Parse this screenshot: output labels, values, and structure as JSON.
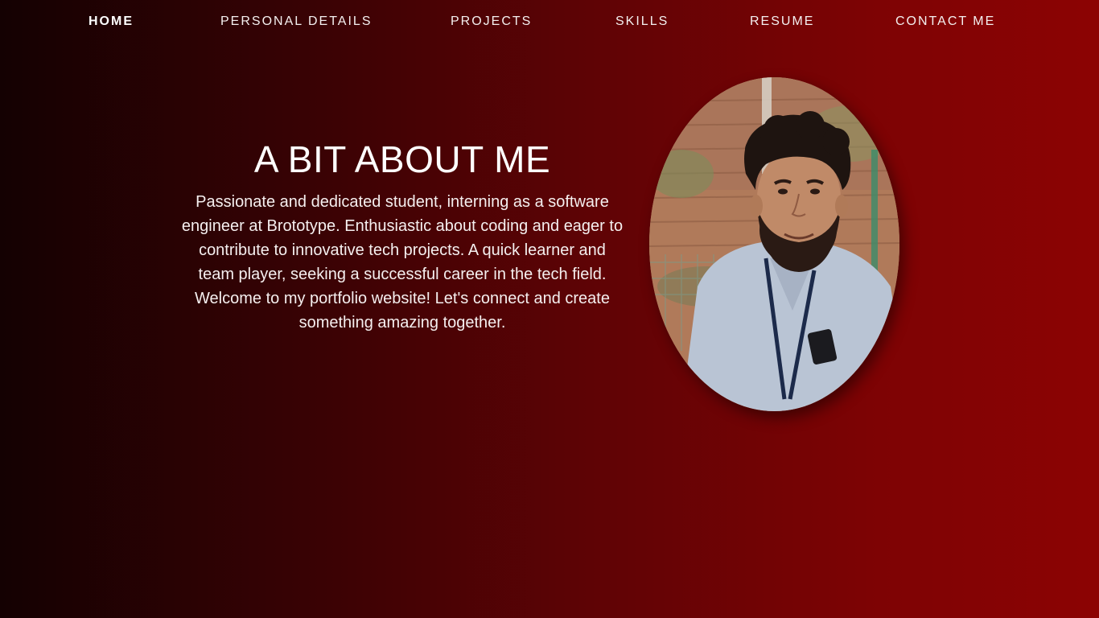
{
  "nav": {
    "items": [
      {
        "label": "HOME",
        "active": true
      },
      {
        "label": "PERSONAL DETAILS",
        "active": false
      },
      {
        "label": "PROJECTS",
        "active": false
      },
      {
        "label": "SKILLS",
        "active": false
      },
      {
        "label": "RESUME",
        "active": false
      },
      {
        "label": "CONTACT ME",
        "active": false
      }
    ]
  },
  "about": {
    "heading": "A BIT ABOUT ME",
    "text": "Passionate and dedicated student, interning as a software engineer at Brototype. Enthusiastic about coding and eager to contribute to innovative tech projects. A quick learner and team player, seeking a successful career in the tech field. Welcome to my portfolio website! Let's connect and create something amazing together."
  },
  "colors": {
    "background_left": "#140102",
    "background_right": "#8c0303",
    "text": "#ffffff"
  }
}
